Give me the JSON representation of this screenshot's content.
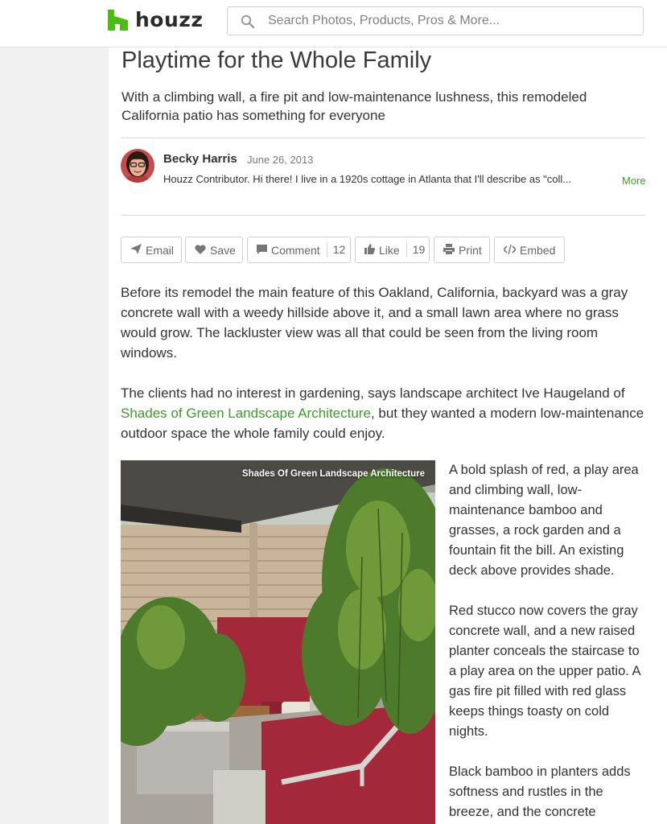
{
  "header": {
    "logo_text": "houzz",
    "brand_color": "#4dbc15",
    "search": {
      "placeholder": "Search Photos, Products, Pros & More...",
      "icon": "search-icon"
    }
  },
  "article": {
    "title": "Playtime for the Whole Family",
    "subtitle": "With a climbing wall, a fire pit and low-maintenance lushness, this remodeled California patio has something for everyone",
    "author": {
      "name": "Becky Harris",
      "date": "June 26, 2013",
      "bio": "Houzz Contributor. Hi there! I live in a 1920s cottage in Atlanta that I'll describe as \"coll...",
      "more_label": "More"
    },
    "actions": [
      {
        "label": "Email",
        "icon": "send-icon"
      },
      {
        "label": "Save",
        "icon": "heart-icon"
      },
      {
        "label": "Comment",
        "icon": "comment-icon",
        "count": "12"
      },
      {
        "label": "Like",
        "icon": "thumbs-up-icon",
        "count": "19"
      },
      {
        "label": "Print",
        "icon": "print-icon"
      },
      {
        "label": "Embed",
        "icon": "code-icon"
      }
    ],
    "paragraphs": [
      "Before its remodel the main feature of this Oakland, California, backyard was a gray concrete wall with a weedy hillside above it, and a small lawn area where no grass would grow. The lackluster view was all that could be seen from the living room windows.",
      {
        "before": "The clients had no interest in gardening, says landscape architect Ive Haugeland of ",
        "link": "Shades of Green Landscape Architecture",
        "after": ", but they wanted a modern low-maintenance outdoor space the whole family could enjoy."
      }
    ],
    "photo_credit": "Shades Of Green Landscape Architecture",
    "side_paragraphs": [
      "A bold splash of red, a play area and climbing wall, low-maintenance bamboo and grasses, a rock garden and a fountain fit the bill. An existing deck above provides shade.",
      "Red stucco now covers the gray concrete wall, and a new raised planter conceals the staircase to a play area on the upper patio. A gas fire pit filled with red glass keeps things toasty on cold nights.",
      "Black bamboo in planters adds softness and rustles in the breeze, and the concrete"
    ],
    "link_color": "#3d9a2a"
  }
}
